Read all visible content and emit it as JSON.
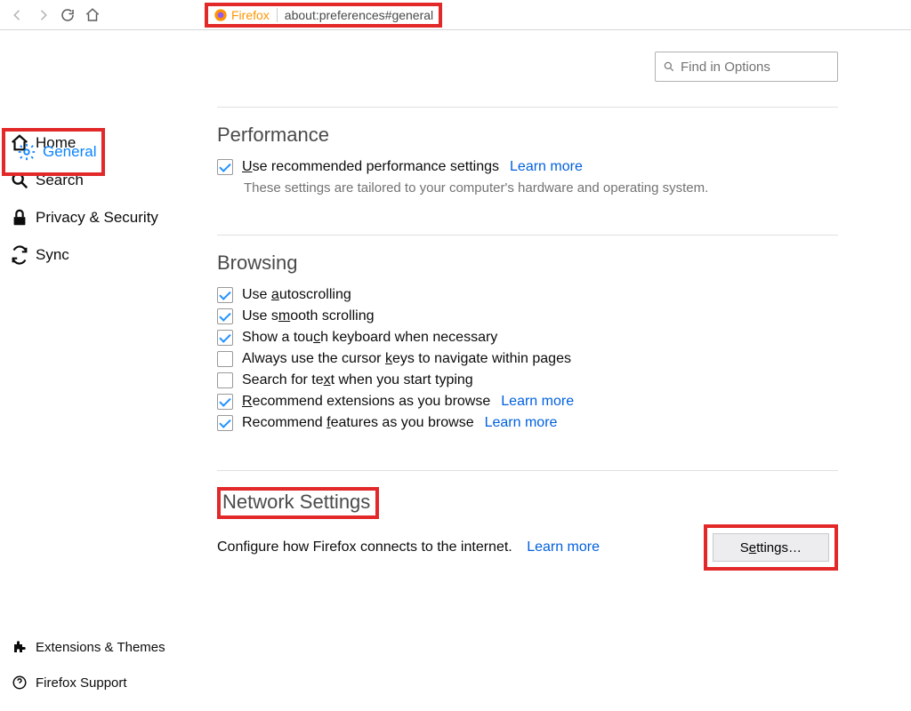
{
  "toolbar": {
    "brand": "Firefox",
    "url": "about:preferences#general"
  },
  "search": {
    "placeholder": "Find in Options"
  },
  "sidebar": {
    "items": [
      {
        "label": "General",
        "active": true
      },
      {
        "label": "Home"
      },
      {
        "label": "Search"
      },
      {
        "label": "Privacy & Security"
      },
      {
        "label": "Sync"
      }
    ],
    "bottom": [
      {
        "label": "Extensions & Themes"
      },
      {
        "label": "Firefox Support"
      }
    ]
  },
  "sections": {
    "performance": {
      "title": "Performance",
      "opt_recommended_pre": "U",
      "opt_recommended_post": "se recommended performance settings",
      "learn": "Learn more",
      "hint": "These settings are tailored to your computer's hardware and operating system."
    },
    "browsing": {
      "title": "Browsing",
      "autoscroll_pre": "Use ",
      "autoscroll_u": "a",
      "autoscroll_post": "utoscrolling",
      "smooth_pre": "Use s",
      "smooth_u": "m",
      "smooth_post": "ooth scrolling",
      "touch_pre": "Show a tou",
      "touch_u": "c",
      "touch_post": "h keyboard when necessary",
      "cursor_pre": "Always use the cursor ",
      "cursor_u": "k",
      "cursor_post": "eys to navigate within pages",
      "typeahead_pre": "Search for te",
      "typeahead_u": "x",
      "typeahead_post": "t when you start typing",
      "recext_pre": "",
      "recext_u": "R",
      "recext_post": "ecommend extensions as you browse",
      "recfeat_pre": "Recommend ",
      "recfeat_u": "f",
      "recfeat_post": "eatures as you browse",
      "learn": "Learn more"
    },
    "network": {
      "title": "Network Settings",
      "desc": "Configure how Firefox connects to the internet.",
      "learn": "Learn more",
      "button_pre": "S",
      "button_u": "e",
      "button_post": "ttings…"
    }
  }
}
